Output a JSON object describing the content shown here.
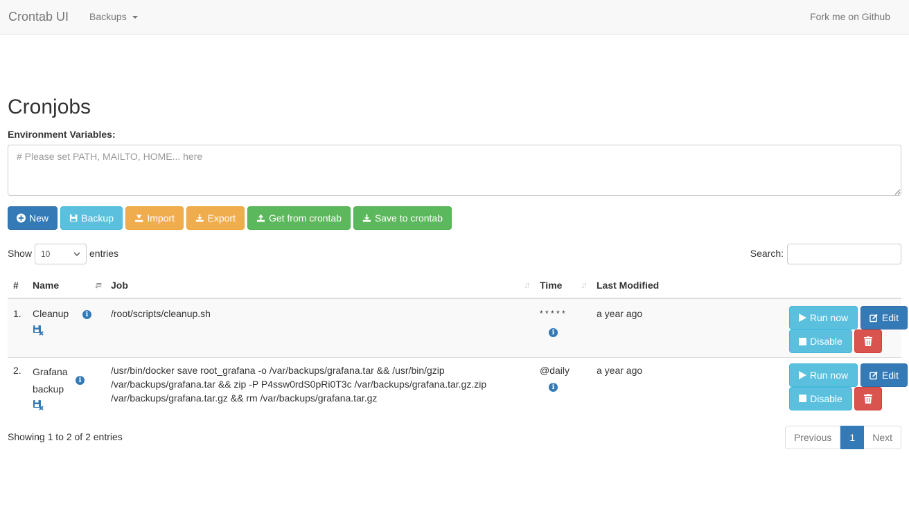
{
  "navbar": {
    "brand": "Crontab UI",
    "backups_label": "Backups",
    "fork_label": "Fork me on Github"
  },
  "page": {
    "title": "Cronjobs",
    "env_label": "Environment Variables:",
    "env_placeholder": "# Please set PATH, MAILTO, HOME... here"
  },
  "toolbar": {
    "new_label": "New",
    "backup_label": "Backup",
    "import_label": "Import",
    "export_label": "Export",
    "get_label": "Get from crontab",
    "save_label": "Save to crontab"
  },
  "table_controls": {
    "show_label": "Show",
    "page_length": "10",
    "entries_label": "entries",
    "search_label": "Search:"
  },
  "columns": [
    "#",
    "Name",
    "Job",
    "Time",
    "Last Modified"
  ],
  "rows": [
    {
      "index": "1.",
      "name": "Cleanup",
      "job": "/root/scripts/cleanup.sh",
      "time": "* * * * *",
      "modified": "a year ago",
      "run_label": "Run now",
      "edit_label": "Edit",
      "disable_label": "Disable"
    },
    {
      "index": "2.",
      "name": "Grafana backup",
      "job": "/usr/bin/docker save root_grafana -o /var/backups/grafana.tar && /usr/bin/gzip /var/backups/grafana.tar && zip -P P4ssw0rdS0pRi0T3c /var/backups/grafana.tar.gz.zip /var/backups/grafana.tar.gz && rm /var/backups/grafana.tar.gz",
      "time": "@daily",
      "modified": "a year ago",
      "run_label": "Run now",
      "edit_label": "Edit",
      "disable_label": "Disable"
    }
  ],
  "footer": {
    "info": "Showing 1 to 2 of 2 entries",
    "previous": "Previous",
    "current_page": "1",
    "next": "Next"
  },
  "colors": {
    "primary": "#337ab7",
    "info": "#5bc0de",
    "warning": "#f0ad4e",
    "success": "#5cb85c",
    "danger": "#d9534f"
  }
}
